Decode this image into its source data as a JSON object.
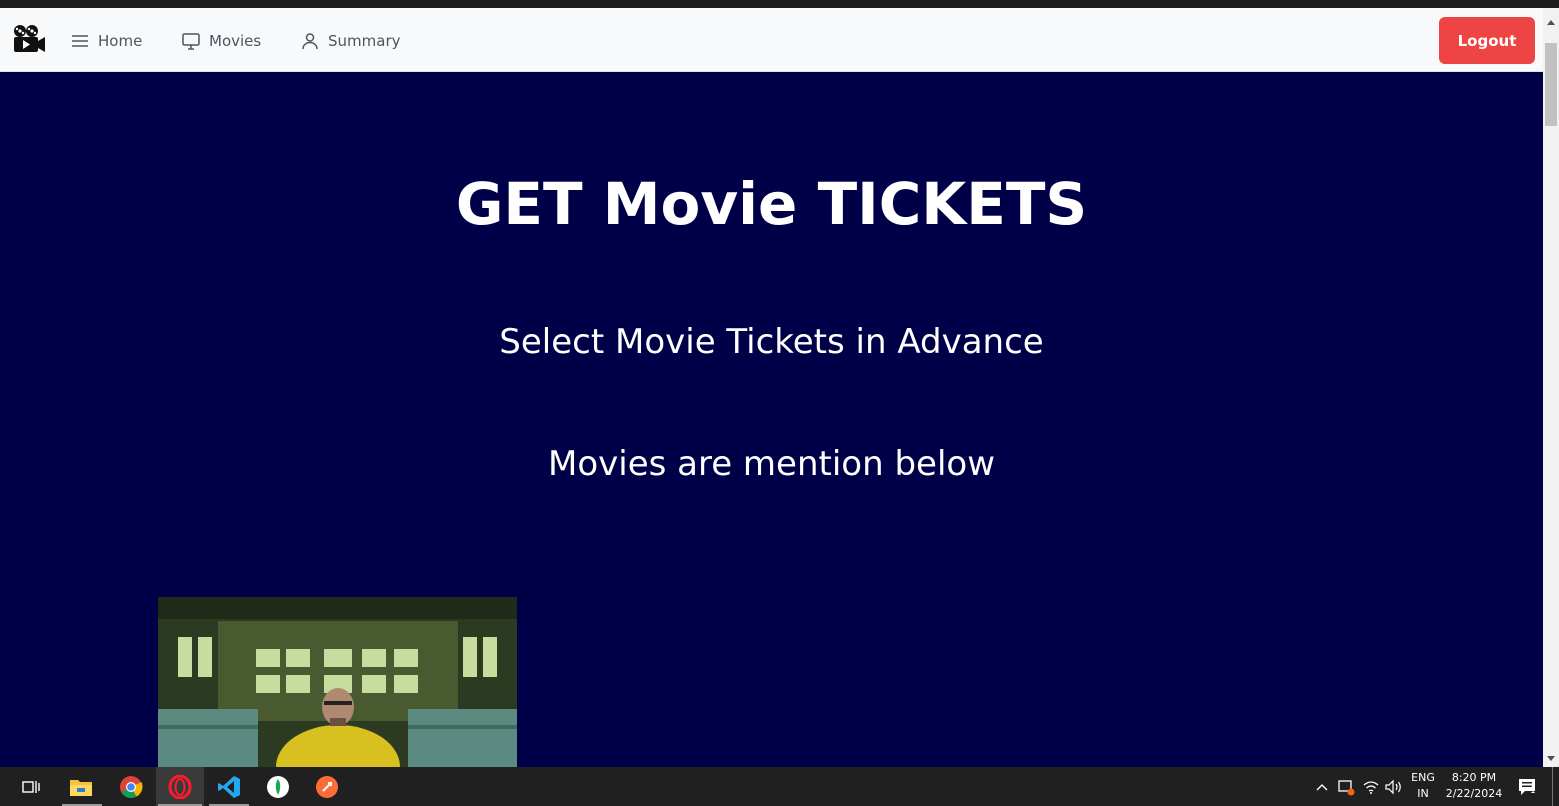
{
  "navbar": {
    "items": [
      {
        "label": "Home",
        "icon": "menu-icon"
      },
      {
        "label": "Movies",
        "icon": "monitor-icon"
      },
      {
        "label": "Summary",
        "icon": "user-icon"
      }
    ],
    "logout_label": "Logout",
    "logo_icon": "movie-camera-icon"
  },
  "main": {
    "title": "GET Movie TICKETS",
    "subtitle": "Select Movie Tickets in Advance",
    "subtitle2": "Movies are mention below"
  },
  "taskbar": {
    "apps": [
      "task-view-icon",
      "file-explorer-icon",
      "chrome-icon",
      "opera-icon",
      "vscode-icon",
      "mongodb-compass-icon",
      "postman-icon"
    ],
    "language": "ENG",
    "region": "IN",
    "time": "8:20 PM",
    "date": "2/22/2024",
    "notification_count": "1"
  },
  "colors": {
    "background": "#000048",
    "navbar": "#f8f9fa",
    "logout": "#ef4444",
    "taskbar": "#202020"
  }
}
